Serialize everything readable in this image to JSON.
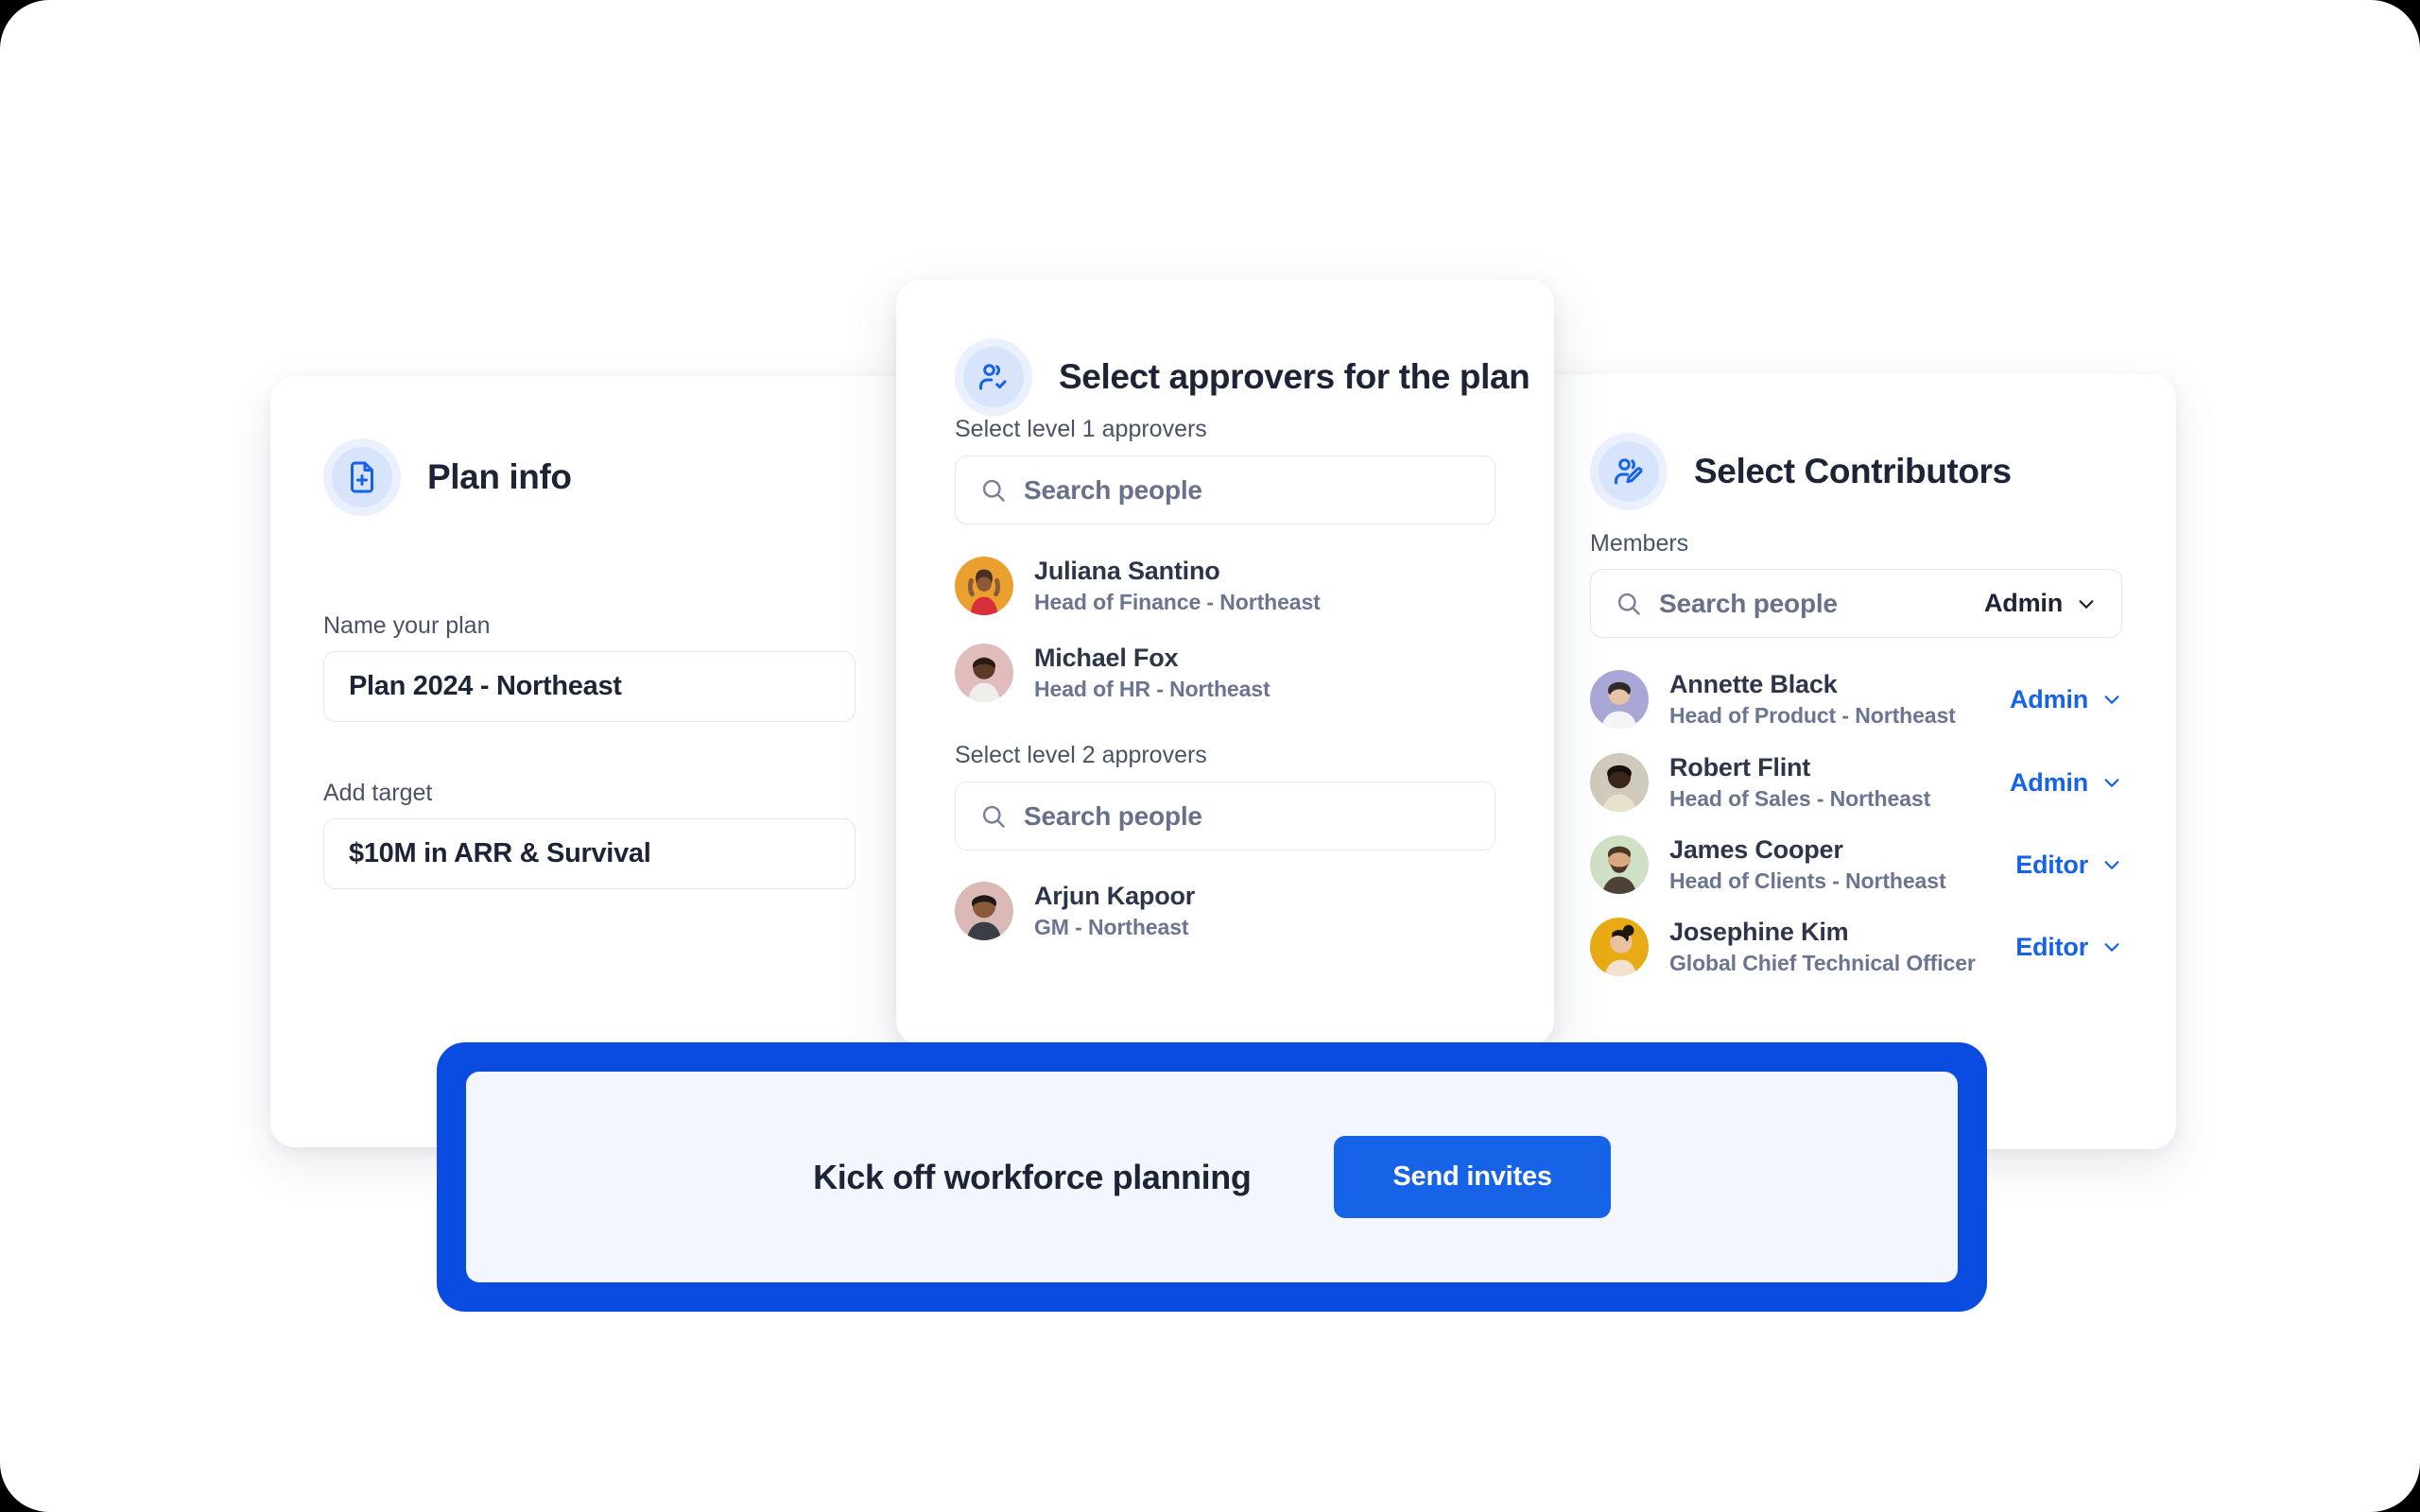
{
  "colors": {
    "accent_blue": "#1763e8",
    "deep_blue": "#0b4ce0",
    "badge_bg": "#d7e4fc",
    "panel_bg": "#f3f6fd",
    "title_ink": "#1c2436",
    "muted_ink": "#6b7490"
  },
  "plan_card": {
    "icon": "document-plus-icon",
    "title": "Plan info",
    "fields": [
      {
        "label": "Name your plan",
        "value": "Plan 2024 - Northeast"
      },
      {
        "label": "Add target",
        "value": "$10M in ARR & Survival"
      }
    ]
  },
  "approvers_card": {
    "icon": "user-check-icon",
    "title": "Select approvers for the plan",
    "search_icon": "search-icon",
    "groups": [
      {
        "label": "Select level 1 approvers",
        "search_placeholder": "Search people",
        "people": [
          {
            "name": "Juliana Santino",
            "role": "Head of Finance - Northeast",
            "avatar": "avatar-juliana"
          },
          {
            "name": "Michael Fox",
            "role": "Head of HR - Northeast",
            "avatar": "avatar-michael"
          }
        ]
      },
      {
        "label": "Select level 2 approvers",
        "search_placeholder": "Search people",
        "people": [
          {
            "name": "Arjun Kapoor",
            "role": "GM - Northeast",
            "avatar": "avatar-arjun"
          }
        ]
      }
    ]
  },
  "contributors_card": {
    "icon": "user-edit-icon",
    "title": "Select Contributors",
    "section_label": "Members",
    "search_placeholder": "Search people",
    "search_role": "Admin",
    "search_role_chevron": "chevron-down-icon",
    "members": [
      {
        "name": "Annette Black",
        "role": "Head of Product - Northeast",
        "permission": "Admin",
        "avatar": "avatar-annette"
      },
      {
        "name": "Robert Flint",
        "role": "Head of Sales - Northeast",
        "permission": "Admin",
        "avatar": "avatar-robert"
      },
      {
        "name": "James Cooper",
        "role": "Head of Clients - Northeast",
        "permission": "Editor",
        "avatar": "avatar-james"
      },
      {
        "name": "Josephine Kim",
        "role": "Global Chief Technical Officer",
        "permission": "Editor",
        "avatar": "avatar-josephine"
      }
    ]
  },
  "cta": {
    "headline": "Kick off workforce planning",
    "button_label": "Send invites"
  }
}
